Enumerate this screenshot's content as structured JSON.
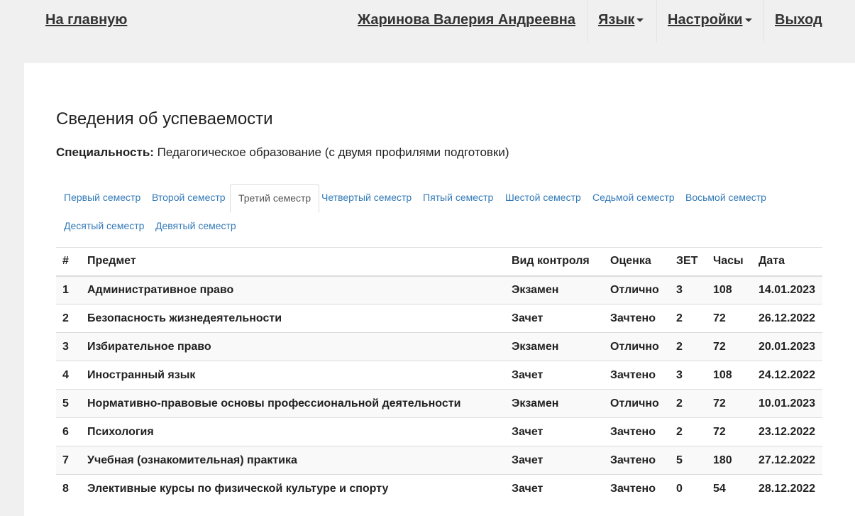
{
  "nav": {
    "home": "На главную",
    "user": "Жаринова Валерия Андреевна",
    "language": "Язык",
    "settings": "Настройки",
    "logout": "Выход"
  },
  "page": {
    "title": "Сведения об успеваемости",
    "specialty_label": "Специальность:",
    "specialty_value": "Педагогическое образование (с двумя профилями подготовки)"
  },
  "tabs": [
    {
      "label": "Первый семестр",
      "active": false
    },
    {
      "label": "Второй семестр",
      "active": false
    },
    {
      "label": "Третий семестр",
      "active": true
    },
    {
      "label": "Четвертый семестр",
      "active": false
    },
    {
      "label": "Пятый семестр",
      "active": false
    },
    {
      "label": "Шестой семестр",
      "active": false
    },
    {
      "label": "Седьмой семестр",
      "active": false
    },
    {
      "label": "Восьмой семестр",
      "active": false
    },
    {
      "label": "Десятый семестр",
      "active": false
    },
    {
      "label": "Девятый семестр",
      "active": false
    }
  ],
  "table": {
    "headers": [
      "#",
      "Предмет",
      "Вид контроля",
      "Оценка",
      "ЗЕТ",
      "Часы",
      "Дата"
    ],
    "rows": [
      [
        "1",
        "Административное право",
        "Экзамен",
        "Отлично",
        "3",
        "108",
        "14.01.2023"
      ],
      [
        "2",
        "Безопасность жизнедеятельности",
        "Зачет",
        "Зачтено",
        "2",
        "72",
        "26.12.2022"
      ],
      [
        "3",
        "Избирательное право",
        "Экзамен",
        "Отлично",
        "2",
        "72",
        "20.01.2023"
      ],
      [
        "4",
        "Иностранный язык",
        "Зачет",
        "Зачтено",
        "3",
        "108",
        "24.12.2022"
      ],
      [
        "5",
        "Нормативно-правовые основы профессиональной деятельности",
        "Экзамен",
        "Отлично",
        "2",
        "72",
        "10.01.2023"
      ],
      [
        "6",
        "Психология",
        "Зачет",
        "Зачтено",
        "2",
        "72",
        "23.12.2022"
      ],
      [
        "7",
        "Учебная (ознакомительная) практика",
        "Зачет",
        "Зачтено",
        "5",
        "180",
        "27.12.2022"
      ],
      [
        "8",
        "Элективные курсы по физической культуре и спорту",
        "Зачет",
        "Зачтено",
        "0",
        "54",
        "28.12.2022"
      ]
    ]
  },
  "colors": {
    "link": "#337ab7",
    "background": "#f0f0f0",
    "panel": "#ffffff",
    "stripe": "#f9f9f9"
  }
}
